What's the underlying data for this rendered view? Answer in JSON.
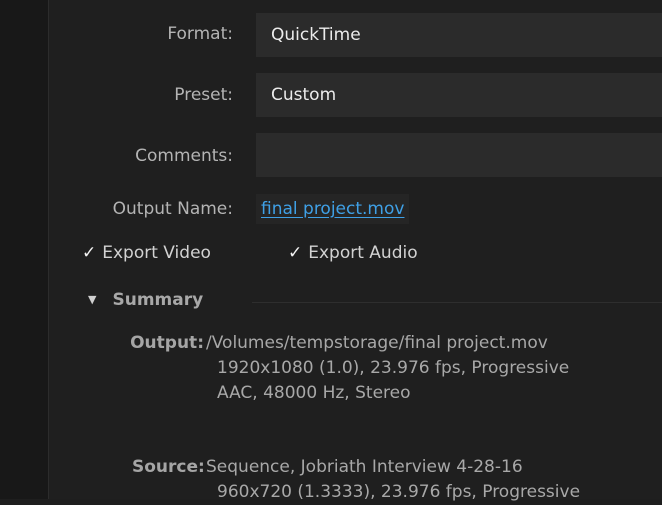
{
  "form": {
    "format_label": "Format:",
    "format_value": "QuickTime",
    "preset_label": "Preset:",
    "preset_value": "Custom",
    "comments_label": "Comments:",
    "comments_value": "",
    "output_name_label": "Output Name:",
    "output_name_value": "final project.mov"
  },
  "checks": {
    "export_video": "Export Video",
    "export_audio": "Export Audio",
    "mark": "✓"
  },
  "summary": {
    "title": "Summary",
    "output_key": "Output:",
    "output_lines": [
      "/Volumes/tempstorage/final project.mov",
      "1920x1080 (1.0), 23.976 fps, Progressive",
      "AAC, 48000 Hz, Stereo"
    ],
    "source_key": "Source:",
    "source_lines": [
      "Sequence, Jobriath Interview 4-28-16",
      "960x720 (1.3333), 23.976 fps, Progressive"
    ]
  }
}
